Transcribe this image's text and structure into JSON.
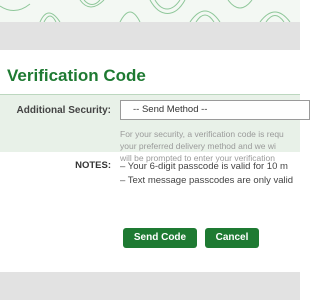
{
  "page": {
    "title": "Verification Code",
    "accent_color": "#1e7a32"
  },
  "security": {
    "label": "Additional Security:",
    "select_value": "-- Send Method --",
    "help_lines": [
      "For your security, a verification code is requ",
      "your preferred delivery method and we wi",
      "will be prompted to enter your verification"
    ]
  },
  "notes": {
    "label": "NOTES:",
    "lines": [
      "– Your 6-digit passcode is valid for 10 m",
      "– Text message passcodes are only valid"
    ]
  },
  "actions": {
    "send_label": "Send Code",
    "cancel_label": "Cancel"
  },
  "banner": {
    "pattern_icon": "tree-ring-pattern-icon"
  }
}
